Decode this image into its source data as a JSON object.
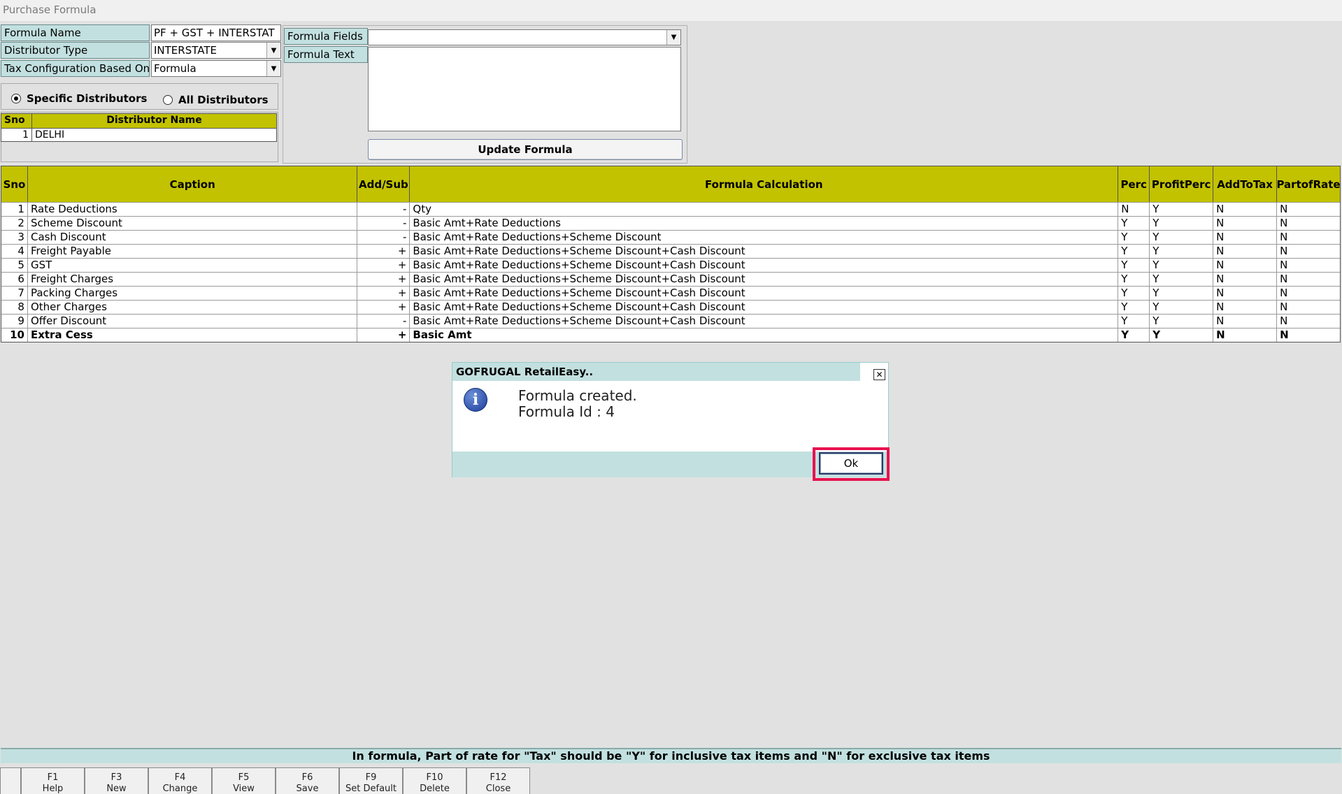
{
  "window": {
    "title": "Purchase Formula"
  },
  "form": {
    "formula_name_label": "Formula Name",
    "formula_name_value": "PF + GST + INTERSTAT",
    "distributor_type_label": "Distributor Type",
    "distributor_type_value": "INTERSTATE",
    "tax_config_label": "Tax Configuration Based On",
    "tax_config_value": "Formula"
  },
  "radio": {
    "specific_label": "Specific Distributors",
    "all_label": "All Distributors",
    "selected": "specific"
  },
  "distributors": {
    "headers": [
      "Sno",
      "Distributor Name"
    ],
    "rows": [
      {
        "sno": "1",
        "name": "DELHI"
      }
    ]
  },
  "formula_panel": {
    "fields_label": "Formula Fields",
    "fields_value": "",
    "text_label": "Formula Text",
    "text_value": "",
    "update_button": "Update Formula"
  },
  "grid": {
    "headers": [
      "Sno",
      "Caption",
      "Add/Sub",
      "Formula Calculation",
      "Perc",
      "ProfitPerc",
      "AddToTax",
      "PartofRate"
    ],
    "rows": [
      {
        "sno": "1",
        "caption": "Rate Deductions",
        "addsub": "-",
        "formula": "Qty",
        "perc": "N",
        "profit": "Y",
        "addtotax": "N",
        "partofrate": "N"
      },
      {
        "sno": "2",
        "caption": "Scheme Discount",
        "addsub": "-",
        "formula": "Basic Amt+Rate Deductions",
        "perc": "Y",
        "profit": "Y",
        "addtotax": "N",
        "partofrate": "N"
      },
      {
        "sno": "3",
        "caption": "Cash Discount",
        "addsub": "-",
        "formula": "Basic Amt+Rate Deductions+Scheme Discount",
        "perc": "Y",
        "profit": "Y",
        "addtotax": "N",
        "partofrate": "N"
      },
      {
        "sno": "4",
        "caption": "Freight Payable",
        "addsub": "+",
        "formula": "Basic Amt+Rate Deductions+Scheme Discount+Cash Discount",
        "perc": "Y",
        "profit": "Y",
        "addtotax": "N",
        "partofrate": "N"
      },
      {
        "sno": "5",
        "caption": "GST",
        "addsub": "+",
        "formula": "Basic Amt+Rate Deductions+Scheme Discount+Cash Discount",
        "perc": "Y",
        "profit": "Y",
        "addtotax": "N",
        "partofrate": "N"
      },
      {
        "sno": "6",
        "caption": "Freight Charges",
        "addsub": "+",
        "formula": "Basic Amt+Rate Deductions+Scheme Discount+Cash Discount",
        "perc": "Y",
        "profit": "Y",
        "addtotax": "N",
        "partofrate": "N"
      },
      {
        "sno": "7",
        "caption": "Packing Charges",
        "addsub": "+",
        "formula": "Basic Amt+Rate Deductions+Scheme Discount+Cash Discount",
        "perc": "Y",
        "profit": "Y",
        "addtotax": "N",
        "partofrate": "N"
      },
      {
        "sno": "8",
        "caption": "Other Charges",
        "addsub": "+",
        "formula": "Basic Amt+Rate Deductions+Scheme Discount+Cash Discount",
        "perc": "Y",
        "profit": "Y",
        "addtotax": "N",
        "partofrate": "N"
      },
      {
        "sno": "9",
        "caption": "Offer Discount",
        "addsub": "-",
        "formula": "Basic Amt+Rate Deductions+Scheme Discount+Cash Discount",
        "perc": "Y",
        "profit": "Y",
        "addtotax": "N",
        "partofrate": "N"
      },
      {
        "sno": "10",
        "caption": "Extra Cess",
        "addsub": "+",
        "formula": "Basic Amt",
        "perc": "Y",
        "profit": "Y",
        "addtotax": "N",
        "partofrate": "N"
      }
    ]
  },
  "dialog": {
    "title": "GOFRUGAL RetailEasy..",
    "line1": "Formula created.",
    "line2": "Formula Id : 4",
    "ok_label": "Ok",
    "close_glyph": "✕",
    "icon_glyph": "i"
  },
  "note": "In formula, Part of rate for \"Tax\" should be \"Y\" for inclusive tax items and \"N\" for exclusive tax items",
  "fkeys": [
    {
      "key": "",
      "label": ""
    },
    {
      "key": "F1",
      "label": "Help"
    },
    {
      "key": "F3",
      "label": "New"
    },
    {
      "key": "F4",
      "label": "Change"
    },
    {
      "key": "F5",
      "label": "View"
    },
    {
      "key": "F6",
      "label": "Save"
    },
    {
      "key": "F9",
      "label": "Set Default"
    },
    {
      "key": "F10",
      "label": "Delete"
    },
    {
      "key": "F12",
      "label": "Close"
    }
  ]
}
